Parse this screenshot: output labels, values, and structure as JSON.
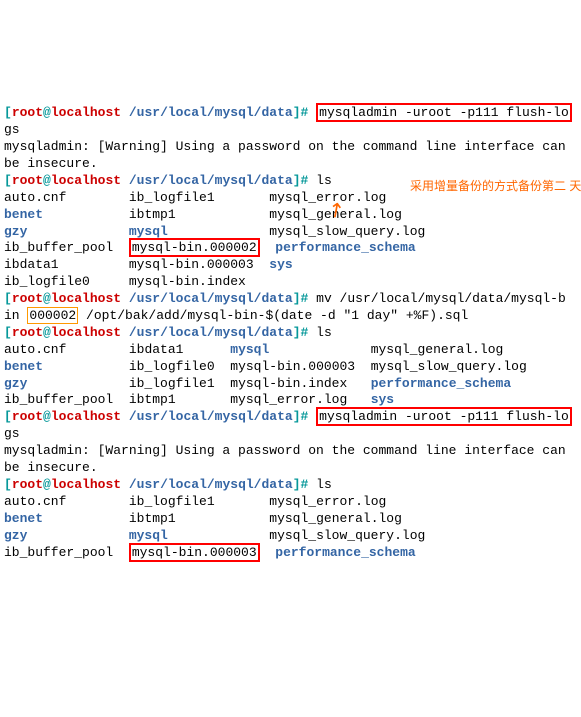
{
  "annotation": "采用增量备份的方式备份第二\n天新生成的数据文件",
  "arrow_glyph": "↗",
  "prompt": {
    "lb": "[",
    "user": "root",
    "at": "@",
    "host": "localhost",
    "cwd": " /usr/local/mysql/data",
    "rb": "]",
    "hash": "#"
  },
  "cmds": {
    "flush1": "mysqladmin -uroot -p111 flush-lo",
    "flush1b": "gs",
    "warn": "mysqladmin: [Warning] Using a password on the command line interface can be insecure.",
    "ls": "ls",
    "mv1": "mv /usr/local/mysql/data/mysql-b",
    "mv2a": "in ",
    "mv2b": "000002",
    "mv2c": " /opt/bak/add/mysql-bin-$(date -d \"1 day\" +%F).sql"
  },
  "ls1": {
    "r1c1": "auto.cnf",
    "r1c2": "ib_logfile1",
    "r1c3": "mysql_error.log",
    "r2c1": "benet",
    "r2c2": "ibtmp1",
    "r2c3": "mysql_general.log",
    "r3c1": "gzy",
    "r3c2": "mysql",
    "r3c3": "mysql_slow_query.log",
    "r4c1": "ib_buffer_pool",
    "r4c2": "mysql-bin.000002",
    "r4c3": "performance_schema",
    "r5c1": "ibdata1",
    "r5c2": "mysql-bin.000003",
    "r5c3": "sys",
    "r6c1": "ib_logfile0",
    "r6c2": "mysql-bin.index"
  },
  "ls2": {
    "r1c1": "auto.cnf",
    "r1c2": "ibdata1",
    "r1c3": "mysql",
    "r1c4": "mysql_general.log",
    "r2c1": "benet",
    "r2c2": "ib_logfile0",
    "r2c3": "mysql-bin.000003",
    "r2c4": "mysql_slow_query.log",
    "r3c1": "gzy",
    "r3c2": "ib_logfile1",
    "r3c3": "mysql-bin.index",
    "r3c4": "performance_schema",
    "r4c1": "ib_buffer_pool",
    "r4c2": "ibtmp1",
    "r4c3": "mysql_error.log",
    "r4c4": "sys"
  },
  "ls3": {
    "r1c1": "auto.cnf",
    "r1c2": "ib_logfile1",
    "r1c3": "mysql_error.log",
    "r2c1": "benet",
    "r2c2": "ibtmp1",
    "r2c3": "mysql_general.log",
    "r3c1": "gzy",
    "r3c2": "mysql",
    "r3c3": "mysql_slow_query.log",
    "r4c1": "ib_buffer_pool",
    "r4c2": "mysql-bin.000003",
    "r4c3": "performance_schema"
  }
}
